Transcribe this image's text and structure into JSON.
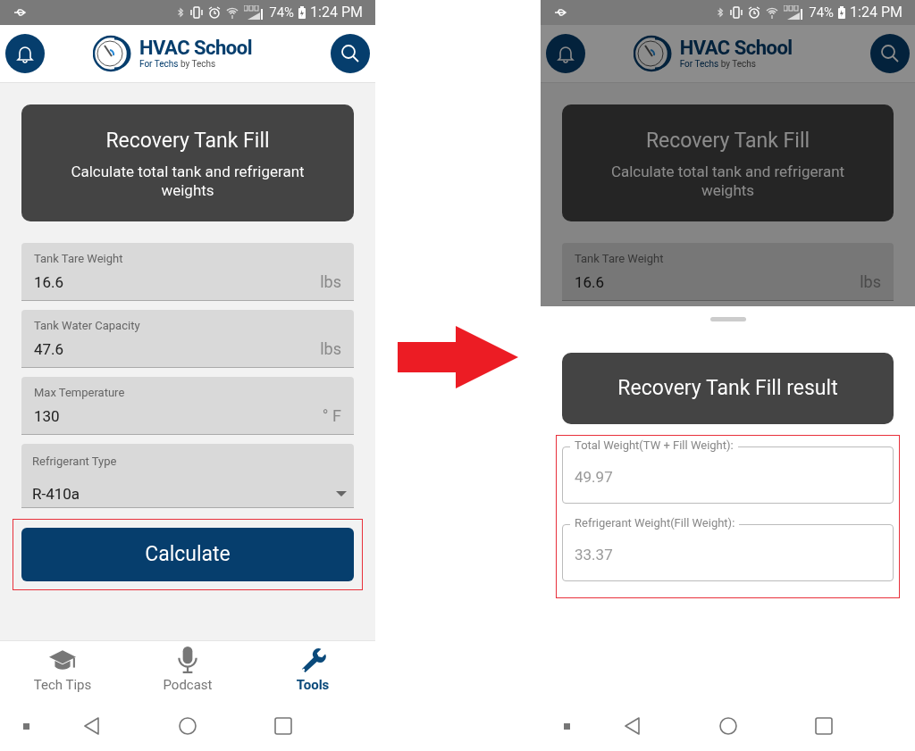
{
  "left_screen": {
    "status_bar": {
      "battery": "74%",
      "time": "1:24 PM"
    },
    "header": {
      "title": "HVAC School",
      "tagline_lead": "For Techs",
      "tagline_rest": "by Techs"
    },
    "tool_card": {
      "title": "Recovery Tank Fill",
      "subtitle": "Calculate total tank and refrigerant weights"
    },
    "fields": [
      {
        "kind": "text",
        "label": "Tank Tare Weight",
        "value": "16.6",
        "unit": "lbs"
      },
      {
        "kind": "text",
        "label": "Tank Water Capacity",
        "value": "47.6",
        "unit": "lbs"
      },
      {
        "kind": "text",
        "label": "Max Temperature",
        "value": "130",
        "unit": "° F"
      },
      {
        "kind": "select",
        "label": "Refrigerant Type",
        "value": "R-410a"
      }
    ],
    "calculate_button": {
      "label": "Calculate",
      "highlighted": true
    },
    "bottom_nav": [
      {
        "label": "Tech Tips",
        "selected": false
      },
      {
        "label": "Podcast",
        "selected": false
      },
      {
        "label": "Tools",
        "selected": true
      }
    ]
  },
  "right_screen": {
    "status_bar": {
      "battery": "74%",
      "time": "1:24 PM"
    },
    "header": {
      "title": "HVAC School",
      "tagline_lead": "For Techs",
      "tagline_rest": "by Techs"
    },
    "tool_card": {
      "title": "Recovery Tank Fill",
      "subtitle": "Calculate total tank and refrigerant weights"
    },
    "fields": [
      {
        "kind": "text",
        "label": "Tank Tare Weight",
        "value": "16.6",
        "unit": "lbs"
      }
    ],
    "dimmed": true,
    "result_sheet": {
      "title": "Recovery Tank Fill result",
      "highlighted": true,
      "results": [
        {
          "label": "Total Weight(TW + Fill Weight):",
          "value": "49.97"
        },
        {
          "label": "Refrigerant Weight(Fill Weight):",
          "value": "33.37"
        }
      ]
    }
  }
}
